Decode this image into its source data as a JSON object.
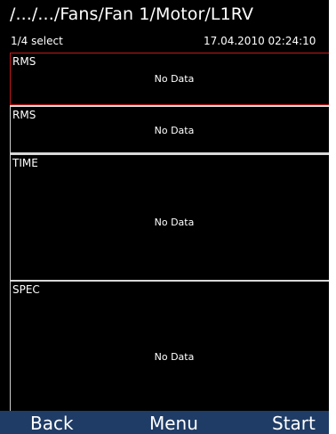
{
  "header": {
    "path": "/.../.../Fans/Fan 1/Motor/L1RV",
    "selection": "1/4 select",
    "datetime": "17.04.2010 02:24:10"
  },
  "panels": [
    {
      "label": "RMS",
      "status": "No Data",
      "selected": true
    },
    {
      "label": "RMS",
      "status": "No Data",
      "selected": false
    },
    {
      "label": "TIME",
      "status": "No Data",
      "selected": false
    },
    {
      "label": "SPEC",
      "status": "No Data",
      "selected": false
    }
  ],
  "softkeys": {
    "back": "Back",
    "menu": "Menu",
    "start": "Start"
  },
  "colors": {
    "background": "#000000",
    "selected_border": "#c01818",
    "panel_border": "#d8d8d8",
    "softkey_bar": "#1f3c66",
    "text": "#ffffff"
  }
}
